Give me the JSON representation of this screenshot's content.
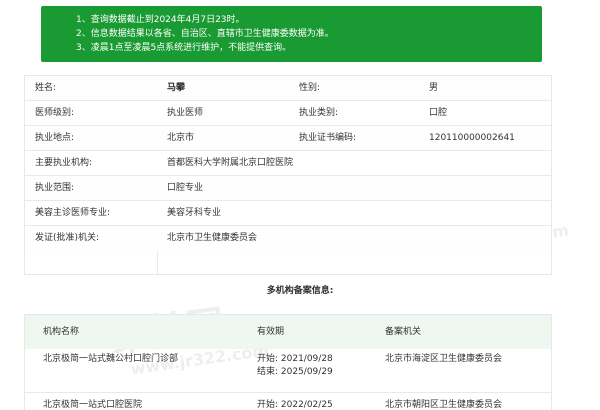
{
  "notice": {
    "lines": [
      "1、查询数据截止到2024年4月7日23时。",
      "2、信息数据结果以各省、自治区、直辖市卫生健康委数据为准。",
      "3、凌晨1点至凌晨5点系统进行维护，不能提供查询。"
    ]
  },
  "profile": {
    "rows": [
      {
        "l1": "姓名:",
        "v1": "马攀",
        "l2": "性别:",
        "v2": "男"
      },
      {
        "l1": "医师级别:",
        "v1": "执业医师",
        "l2": "执业类别:",
        "v2": "口腔"
      },
      {
        "l1": "执业地点:",
        "v1": "北京市",
        "l2": "执业证书编码:",
        "v2": "120110000002641"
      },
      {
        "l1": "主要执业机构:",
        "v1": "首都医科大学附属北京口腔医院"
      },
      {
        "l1": "执业范围:",
        "v1": "口腔专业"
      },
      {
        "l1": "美容主诊医师专业:",
        "v1": "美容牙科专业"
      },
      {
        "l1": "发证(批准)机关:",
        "v1": "北京市卫生健康委员会"
      }
    ]
  },
  "multi": {
    "title": "多机构备案信息:",
    "headers": [
      "机构名称",
      "有效期",
      "备案机关"
    ],
    "rows": [
      {
        "name": "北京极简一站式魏公村口腔门诊部",
        "start": "开始:  2021/09/28",
        "end": "结束:  2025/09/29",
        "agency": "北京市海淀区卫生健康委员会"
      },
      {
        "name": "北京极简一站式口腔医院",
        "start": "开始:  2022/02/25",
        "end": "",
        "agency": "北京市朝阳区卫生健康委员会"
      }
    ]
  },
  "watermark": {
    "text": "聚美网",
    "url": "www.jr322.com"
  }
}
